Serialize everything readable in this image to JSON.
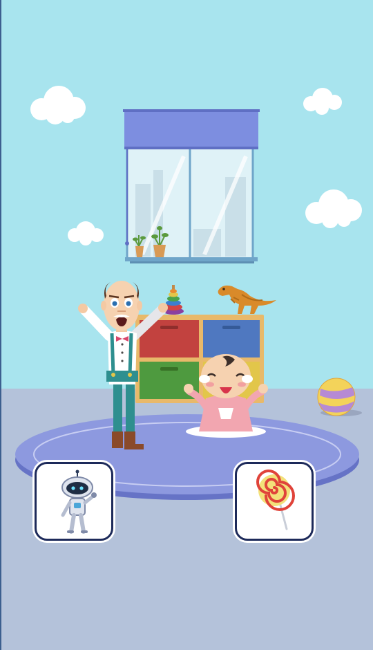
{
  "scene": {
    "wall_color": "#a8e4ee",
    "floor_color": "#b4c2da",
    "rug_color": "#8d99df"
  },
  "choices": [
    {
      "id": "robot",
      "icon": "robot-toy-icon"
    },
    {
      "id": "lollipop",
      "icon": "lollipop-icon"
    }
  ]
}
